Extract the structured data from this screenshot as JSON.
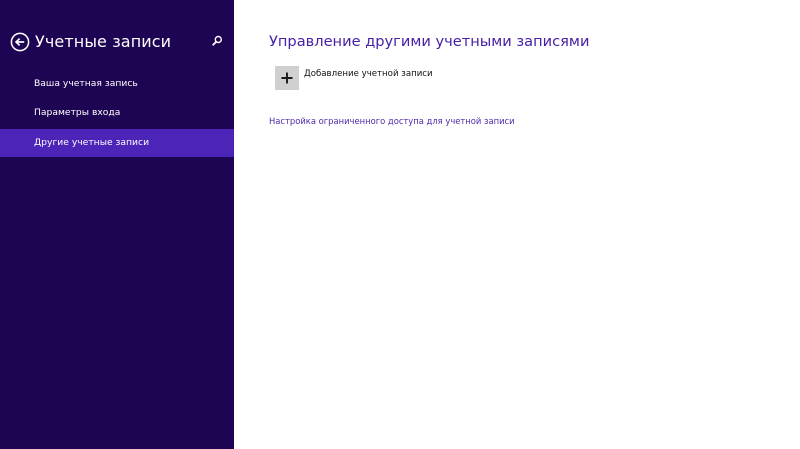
{
  "sidebar": {
    "title": "Учетные записи",
    "back_icon": "back-arrow-circle-icon",
    "search_icon": "search-icon",
    "items": [
      {
        "label": "Ваша учетная запись",
        "active": false
      },
      {
        "label": "Параметры входа",
        "active": false
      },
      {
        "label": "Другие учетные записи",
        "active": true
      }
    ]
  },
  "main": {
    "title": "Управление другими учетными записями",
    "add_account": {
      "icon": "plus-icon",
      "label": "Добавление учетной записи"
    },
    "assigned_access_link": "Настройка ограниченного доступа для учетной записи"
  },
  "colors": {
    "sidebar_bg": "#1e0553",
    "active_item_bg": "#4c24b8",
    "accent": "#4720a8",
    "tile_bg": "#d0d0d0",
    "content_bg": "#ffffff"
  }
}
